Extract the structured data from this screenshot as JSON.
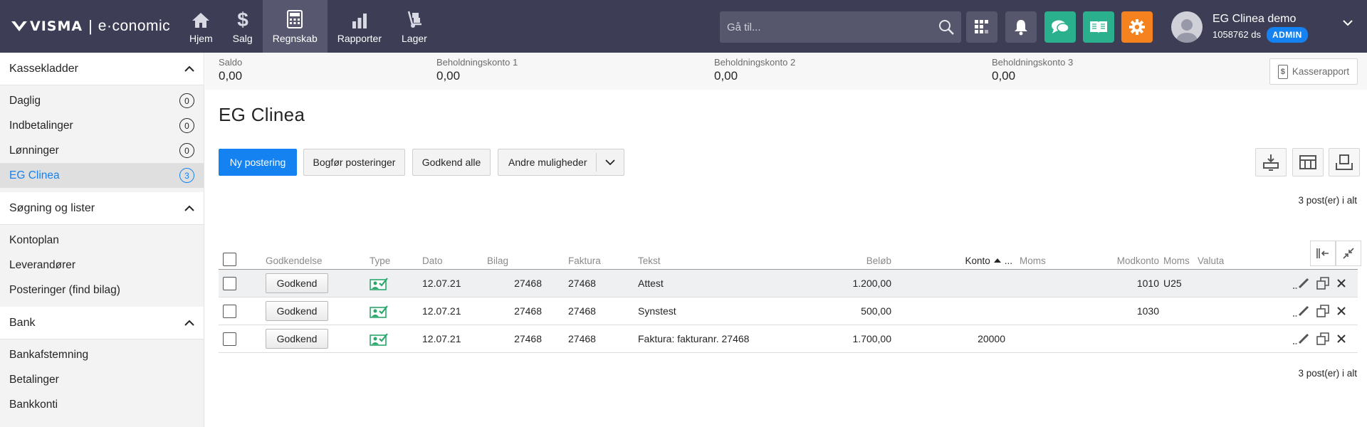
{
  "topbar": {
    "logo_brand": "VISMA",
    "logo_sep": "|",
    "logo_product": "e·conomic",
    "nav": [
      {
        "label": "Hjem",
        "icon": "home-icon",
        "active": false
      },
      {
        "label": "Salg",
        "icon": "dollar-icon",
        "active": false
      },
      {
        "label": "Regnskab",
        "icon": "calculator-icon",
        "active": true
      },
      {
        "label": "Rapporter",
        "icon": "bar-chart-icon",
        "active": false
      },
      {
        "label": "Lager",
        "icon": "hand-truck-icon",
        "active": false
      }
    ],
    "search_placeholder": "Gå til...",
    "user_name": "EG Clinea demo",
    "user_number": "1058762 ds",
    "user_role": "ADMIN",
    "colors": {
      "bg": "#3d3e55",
      "chat": "#2ab08c",
      "book": "#2ab08c",
      "settings": "#f5821f",
      "accent": "#1482f0"
    }
  },
  "sidebar": {
    "sections": [
      {
        "title": "Kassekladder",
        "items": [
          {
            "label": "Daglig",
            "count": "0"
          },
          {
            "label": "Indbetalinger",
            "count": "0"
          },
          {
            "label": "Lønninger",
            "count": "0"
          },
          {
            "label": "EG Clinea",
            "count": "3",
            "active": true
          }
        ]
      },
      {
        "title": "Søgning og lister",
        "items": [
          {
            "label": "Kontoplan"
          },
          {
            "label": "Leverandører"
          },
          {
            "label": "Posteringer (find bilag)"
          }
        ]
      },
      {
        "title": "Bank",
        "items": [
          {
            "label": "Bankafstemning"
          },
          {
            "label": "Betalinger"
          },
          {
            "label": "Bankkonti"
          }
        ]
      }
    ]
  },
  "balances": [
    {
      "label": "Saldo",
      "value": "0,00"
    },
    {
      "label": "Beholdningskonto 1",
      "value": "0,00"
    },
    {
      "label": "Beholdningskonto 2",
      "value": "0,00"
    },
    {
      "label": "Beholdningskonto 3",
      "value": "0,00"
    }
  ],
  "kasserapport_label": "Kasserapport",
  "page_title": "EG Clinea",
  "toolbar": {
    "new_label": "Ny postering",
    "post_label": "Bogfør posteringer",
    "approve_all_label": "Godkend alle",
    "more_label": "Andre muligheder"
  },
  "post_count": "3 post(er) i alt",
  "table": {
    "headers": {
      "approval": "Godkendelse",
      "type": "Type",
      "date": "Dato",
      "voucher": "Bilag",
      "invoice": "Faktura",
      "text": "Tekst",
      "amount": "Beløb",
      "account": "Konto",
      "account_more": "...",
      "vat": "Moms",
      "contra": "Modkonto",
      "contra_vat": "Moms",
      "currency": "Valuta"
    },
    "approve_label": "Godkend",
    "rows": [
      {
        "date": "12.07.21",
        "voucher": "27468",
        "invoice": "27468",
        "text": "Attest",
        "amount": "1.200,00",
        "account": "",
        "vat": "",
        "contra": "1010",
        "contra_vat": "U25",
        "currency": ""
      },
      {
        "date": "12.07.21",
        "voucher": "27468",
        "invoice": "27468",
        "text": "Synstest",
        "amount": "500,00",
        "account": "",
        "vat": "",
        "contra": "1030",
        "contra_vat": "",
        "currency": ""
      },
      {
        "date": "12.07.21",
        "voucher": "27468",
        "invoice": "27468",
        "text": "Faktura: fakturanr. 27468",
        "amount": "1.700,00",
        "account": "20000",
        "vat": "",
        "contra": "",
        "contra_vat": "",
        "currency": ""
      }
    ]
  }
}
